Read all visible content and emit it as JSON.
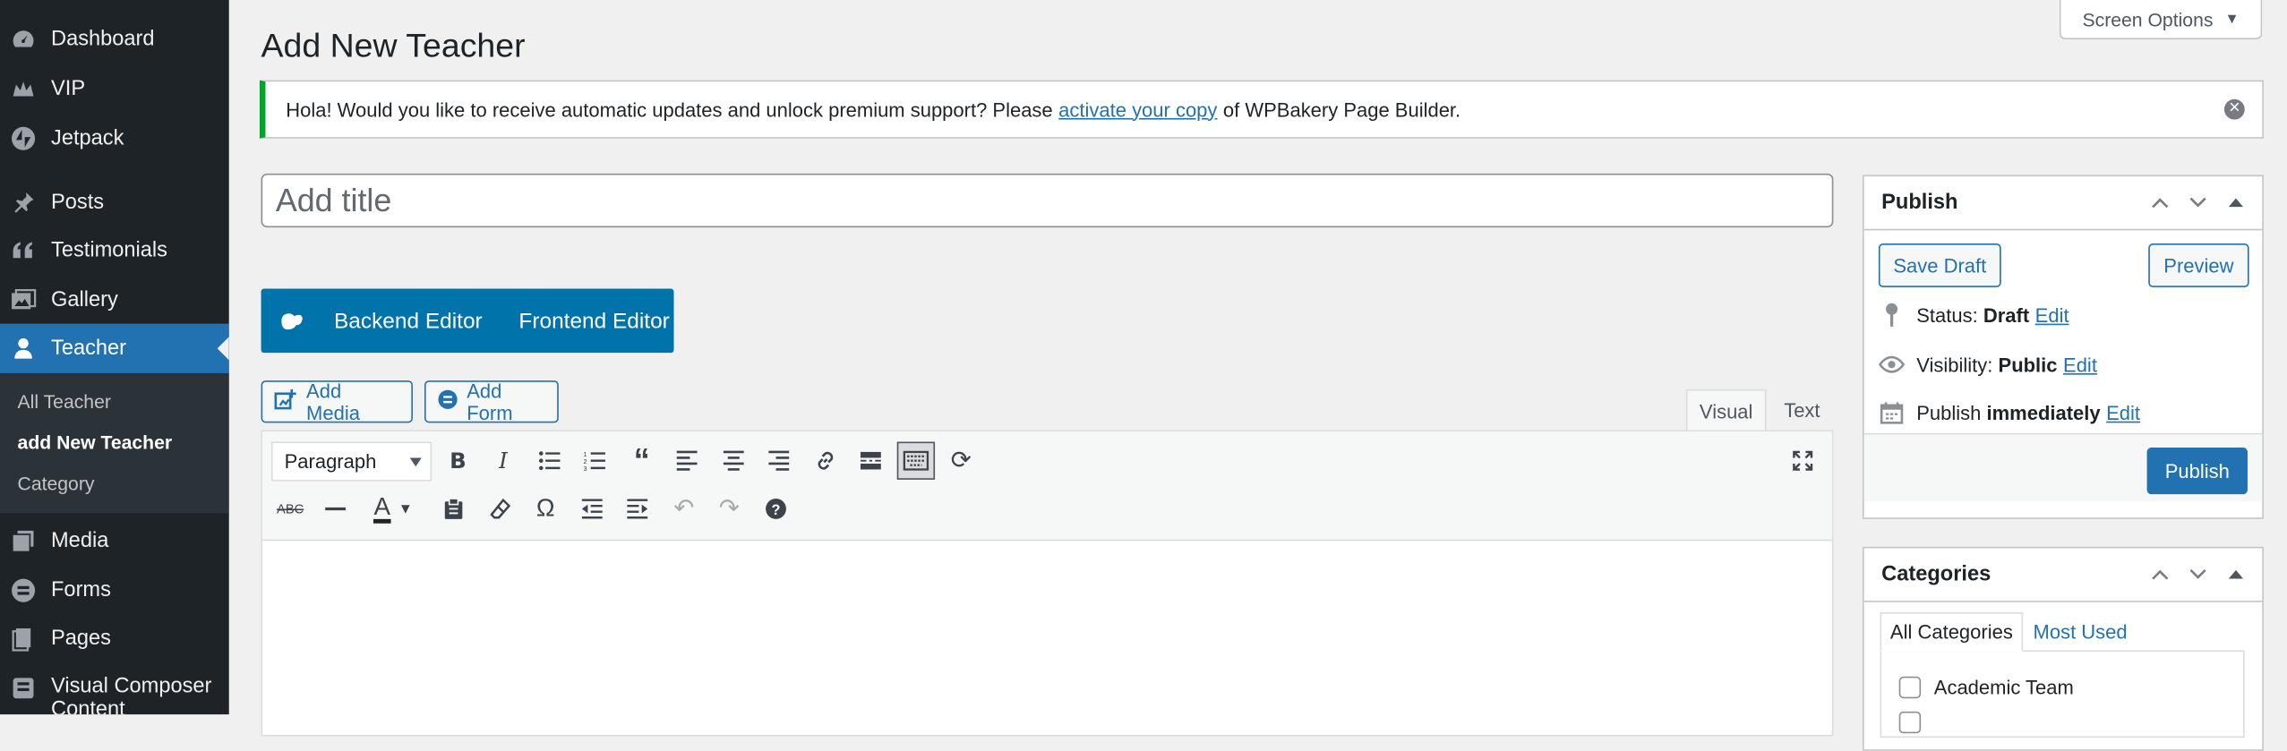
{
  "sidebar": {
    "items": [
      {
        "label": "Dashboard",
        "icon": "dashboard-icon"
      },
      {
        "label": "VIP",
        "icon": "vip-icon"
      },
      {
        "label": "Jetpack",
        "icon": "jetpack-icon"
      },
      {
        "label": "Posts",
        "icon": "pin-icon"
      },
      {
        "label": "Testimonials",
        "icon": "quote-icon"
      },
      {
        "label": "Gallery",
        "icon": "gallery-icon"
      },
      {
        "label": "Teacher",
        "icon": "user-icon"
      },
      {
        "label": "Media",
        "icon": "media-icon"
      },
      {
        "label": "Forms",
        "icon": "forms-icon"
      },
      {
        "label": "Pages",
        "icon": "pages-icon"
      },
      {
        "label": "Visual Composer Content",
        "icon": "composer-icon"
      }
    ],
    "submenu": [
      "All Teacher",
      "add New Teacher",
      "Category"
    ]
  },
  "header": {
    "title": "Add New Teacher",
    "screen_options": "Screen Options"
  },
  "notice": {
    "text_before": "Hola! Would you like to receive automatic updates and unlock premium support? Please",
    "link": "activate your copy",
    "text_after": "of WPBakery Page Builder."
  },
  "title_field": {
    "placeholder": "Add title",
    "value": ""
  },
  "vc": {
    "backend": "Backend Editor",
    "frontend": "Frontend Editor"
  },
  "media_buttons": {
    "add_media": "Add Media",
    "add_form": "Add Form"
  },
  "editor_tabs": {
    "visual": "Visual",
    "text": "Text"
  },
  "toolbar": {
    "format": "Paragraph"
  },
  "publish": {
    "title": "Publish",
    "save_draft": "Save Draft",
    "preview": "Preview",
    "status_label": "Status:",
    "status_value": "Draft",
    "visibility_label": "Visibility:",
    "visibility_value": "Public",
    "schedule_label": "Publish",
    "schedule_value": "immediately",
    "edit": "Edit",
    "publish_button": "Publish"
  },
  "categories": {
    "title": "Categories",
    "tab_all": "All Categories",
    "tab_used": "Most Used",
    "items": [
      "Academic Team"
    ]
  },
  "colors": {
    "accent": "#2271b1",
    "sidebar": "#1d2327",
    "vc": "#0073aa",
    "notice_border": "#00a32a"
  }
}
